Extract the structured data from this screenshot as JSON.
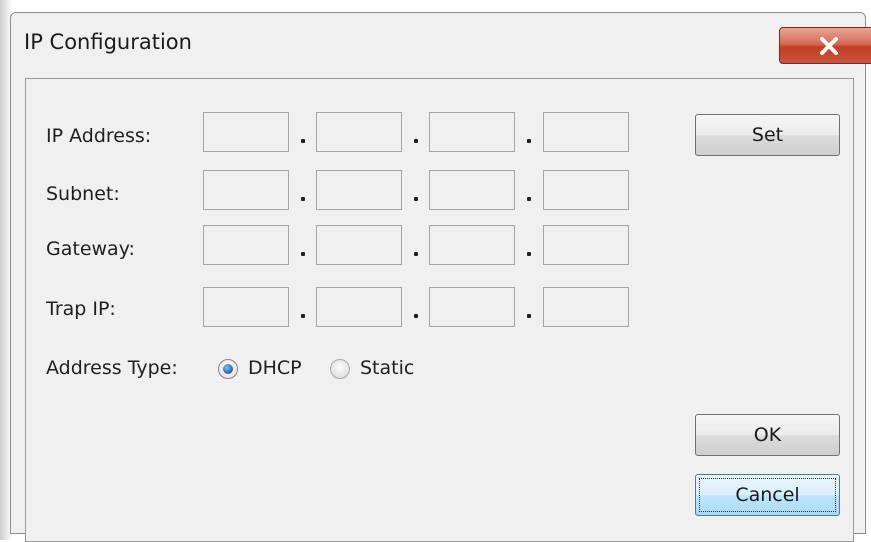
{
  "window": {
    "title": "IP Configuration",
    "close_icon": "close-x-icon",
    "close_color": "#c9402a"
  },
  "fields": [
    {
      "label": "IP Address:",
      "octets": [
        "",
        "",
        "",
        ""
      ]
    },
    {
      "label": "Subnet:",
      "octets": [
        "",
        "",
        "",
        ""
      ]
    },
    {
      "label": "Gateway:",
      "octets": [
        "",
        "",
        "",
        ""
      ]
    },
    {
      "label": "Trap IP:",
      "octets": [
        "",
        "",
        "",
        ""
      ]
    }
  ],
  "address_type": {
    "label": "Address Type:",
    "options": [
      "DHCP",
      "Static"
    ],
    "selected": "DHCP"
  },
  "buttons": {
    "set": "Set",
    "ok": "OK",
    "cancel": "Cancel"
  }
}
